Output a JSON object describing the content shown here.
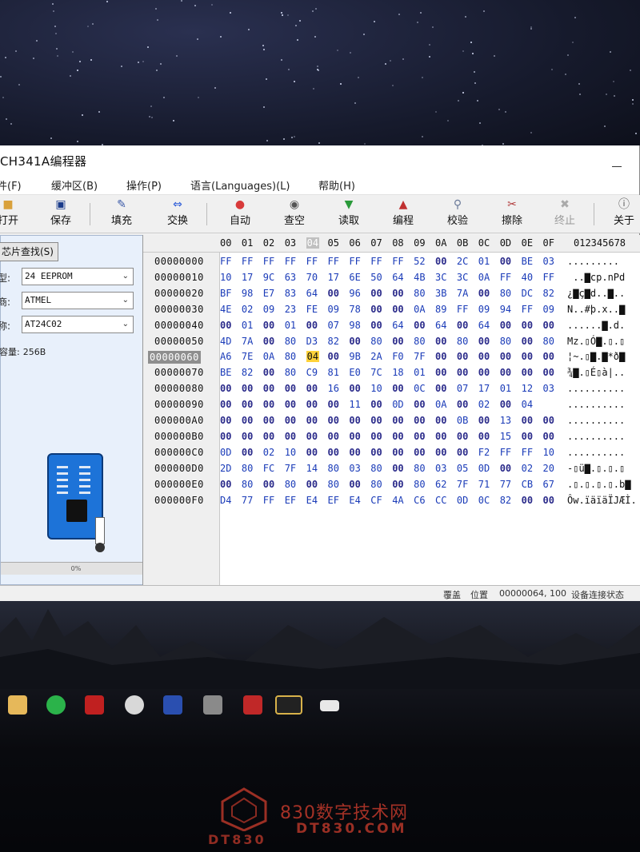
{
  "app": {
    "title": "CH341A编程器"
  },
  "menu": [
    "件(F)",
    "缓冲区(B)",
    "操作(P)",
    "语言(Languages)(L)",
    "帮助(H)"
  ],
  "toolbar": [
    {
      "label": "打开",
      "icon": "folder-icon"
    },
    {
      "label": "保存",
      "icon": "save-icon"
    },
    {
      "label": "填充",
      "icon": "fill-icon"
    },
    {
      "label": "交换",
      "icon": "swap-icon"
    },
    {
      "label": "自动",
      "icon": "auto-icon"
    },
    {
      "label": "查空",
      "icon": "blank-check-icon"
    },
    {
      "label": "读取",
      "icon": "read-icon"
    },
    {
      "label": "编程",
      "icon": "program-icon"
    },
    {
      "label": "校验",
      "icon": "verify-icon"
    },
    {
      "label": "擦除",
      "icon": "erase-icon"
    },
    {
      "label": "终止",
      "icon": "stop-icon"
    },
    {
      "label": "关于",
      "icon": "about-icon"
    }
  ],
  "chip": {
    "find_button": "芯片查找(S)",
    "type_label": "型:",
    "type_value": "24 EEPROM",
    "maker_label": "商:",
    "maker_value": "ATMEL",
    "name_label": "称:",
    "name_value": "AT24C02",
    "capacity_label": "容量:",
    "capacity_value": "256B",
    "progress_text": "0%"
  },
  "hex": {
    "columns": [
      "00",
      "01",
      "02",
      "03",
      "04",
      "05",
      "06",
      "07",
      "08",
      "09",
      "0A",
      "0B",
      "0C",
      "0D",
      "0E",
      "0F"
    ],
    "ascii_header": "012345678",
    "selected_row": 6,
    "selected_col": 4,
    "rows": [
      {
        "addr": "00000000",
        "bytes": [
          "FF",
          "FF",
          "FF",
          "FF",
          "FF",
          "FF",
          "FF",
          "FF",
          "FF",
          "52",
          "00",
          "2C",
          "01",
          "00",
          "BE",
          "03"
        ],
        "ascii": "........."
      },
      {
        "addr": "00000010",
        "bytes": [
          "10",
          "17",
          "9C",
          "63",
          "70",
          "17",
          "6E",
          "50",
          "64",
          "4B",
          "3C",
          "3C",
          "0A",
          "FF",
          "40",
          "FF"
        ],
        "ascii": " ..▇cp.nPd"
      },
      {
        "addr": "00000020",
        "bytes": [
          "BF",
          "98",
          "E7",
          "83",
          "64",
          "00",
          "96",
          "00",
          "00",
          "80",
          "3B",
          "7A",
          "00",
          "80",
          "DC",
          "82"
        ],
        "ascii": "¿▇ç▇d..▇.."
      },
      {
        "addr": "00000030",
        "bytes": [
          "4E",
          "02",
          "09",
          "23",
          "FE",
          "09",
          "78",
          "00",
          "00",
          "0A",
          "89",
          "FF",
          "09",
          "94",
          "FF",
          "09"
        ],
        "ascii": "N..#þ.x..▇"
      },
      {
        "addr": "00000040",
        "bytes": [
          "00",
          "01",
          "00",
          "01",
          "00",
          "07",
          "98",
          "00",
          "64",
          "00",
          "64",
          "00",
          "64",
          "00",
          "00",
          "00"
        ],
        "ascii": "......▇.d."
      },
      {
        "addr": "00000050",
        "bytes": [
          "4D",
          "7A",
          "00",
          "80",
          "D3",
          "82",
          "00",
          "80",
          "00",
          "80",
          "00",
          "80",
          "00",
          "80",
          "00",
          "80"
        ],
        "ascii": "Mz.▯Ó▇.▯.▯"
      },
      {
        "addr": "00000060",
        "bytes": [
          "A6",
          "7E",
          "0A",
          "80",
          "04",
          "00",
          "9B",
          "2A",
          "F0",
          "7F",
          "00",
          "00",
          "00",
          "00",
          "00",
          "00"
        ],
        "ascii": "¦~.▯▇.▇*ð▇"
      },
      {
        "addr": "00000070",
        "bytes": [
          "BE",
          "82",
          "00",
          "80",
          "C9",
          "81",
          "E0",
          "7C",
          "18",
          "01",
          "00",
          "00",
          "00",
          "00",
          "00",
          "00"
        ],
        "ascii": "¾▇.▯É▯à|.."
      },
      {
        "addr": "00000080",
        "bytes": [
          "00",
          "00",
          "00",
          "00",
          "00",
          "16",
          "00",
          "10",
          "00",
          "0C",
          "00",
          "07",
          "17",
          "01",
          "12",
          "03"
        ],
        "ascii": ".........."
      },
      {
        "addr": "00000090",
        "bytes": [
          "00",
          "00",
          "00",
          "00",
          "00",
          "00",
          "11",
          "00",
          "0D",
          "00",
          "0A",
          "00",
          "02",
          "00",
          "04"
        ],
        "ascii": ".........."
      },
      {
        "addr": "000000A0",
        "bytes": [
          "00",
          "00",
          "00",
          "00",
          "00",
          "00",
          "00",
          "00",
          "00",
          "00",
          "00",
          "0B",
          "00",
          "13",
          "00",
          "00"
        ],
        "ascii": ".........."
      },
      {
        "addr": "000000B0",
        "bytes": [
          "00",
          "00",
          "00",
          "00",
          "00",
          "00",
          "00",
          "00",
          "00",
          "00",
          "00",
          "00",
          "00",
          "15",
          "00",
          "00"
        ],
        "ascii": ".........."
      },
      {
        "addr": "000000C0",
        "bytes": [
          "0D",
          "00",
          "02",
          "10",
          "00",
          "00",
          "00",
          "00",
          "00",
          "00",
          "00",
          "00",
          "F2",
          "FF",
          "FF",
          "10"
        ],
        "ascii": ".........."
      },
      {
        "addr": "000000D0",
        "bytes": [
          "2D",
          "80",
          "FC",
          "7F",
          "14",
          "80",
          "03",
          "80",
          "00",
          "80",
          "03",
          "05",
          "0D",
          "00",
          "02",
          "20"
        ],
        "ascii": "-▯ü▇.▯.▯.▯"
      },
      {
        "addr": "000000E0",
        "bytes": [
          "00",
          "80",
          "00",
          "80",
          "00",
          "80",
          "00",
          "80",
          "00",
          "80",
          "62",
          "7F",
          "71",
          "77",
          "CB",
          "67"
        ],
        "ascii": ".▯.▯.▯.▯.b▇"
      },
      {
        "addr": "000000F0",
        "bytes": [
          "D4",
          "77",
          "FF",
          "EF",
          "E4",
          "EF",
          "E4",
          "CF",
          "4A",
          "C6",
          "CC",
          "0D",
          "0C",
          "82",
          "00",
          "00"
        ],
        "ascii": "Ôw.ïäïäÏJÆÌ."
      }
    ]
  },
  "status": {
    "mode": "覆盖",
    "position_label": "位置",
    "position_value": "00000064, 100",
    "device_status": "设备连接状态"
  },
  "watermark": {
    "cn": "830数字技术网",
    "en": "DT830.COM",
    "brand": "DT830"
  }
}
